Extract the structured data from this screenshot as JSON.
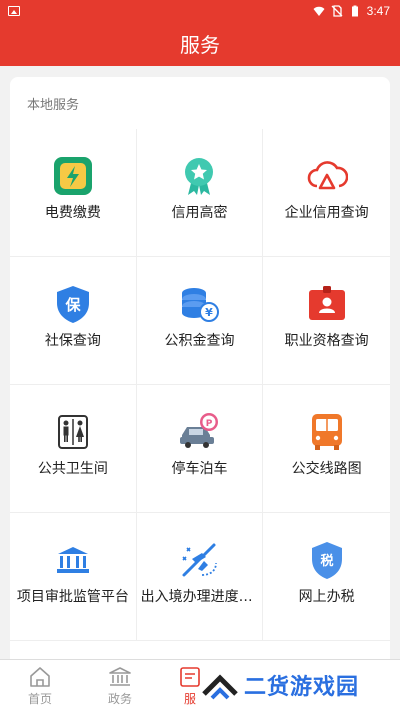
{
  "status_bar": {
    "time": "3:47"
  },
  "header": {
    "title": "服务"
  },
  "section": {
    "title": "本地服务"
  },
  "services": [
    {
      "label": "电费缴费",
      "icon": "electricity-bill-icon"
    },
    {
      "label": "信用高密",
      "icon": "credit-medal-icon"
    },
    {
      "label": "企业信用查询",
      "icon": "cloud-alert-icon"
    },
    {
      "label": "社保查询",
      "icon": "social-security-shield-icon"
    },
    {
      "label": "公积金查询",
      "icon": "fund-database-icon"
    },
    {
      "label": "职业资格查询",
      "icon": "id-badge-icon"
    },
    {
      "label": "公共卫生间",
      "icon": "restroom-icon"
    },
    {
      "label": "停车泊车",
      "icon": "parking-car-icon"
    },
    {
      "label": "公交线路图",
      "icon": "bus-icon"
    },
    {
      "label": "项目审批监管平台",
      "icon": "government-building-icon"
    },
    {
      "label": "出入境办理进度查…",
      "icon": "immigration-plane-icon"
    },
    {
      "label": "网上办税",
      "icon": "tax-shield-icon"
    }
  ],
  "tabs": [
    {
      "label": "首页",
      "icon": "home-icon"
    },
    {
      "label": "政务",
      "icon": "government-icon"
    },
    {
      "label": "服",
      "icon": "service-icon"
    }
  ],
  "watermark": {
    "text": "二货游戏园"
  },
  "colors": {
    "brand": "#e53a2e",
    "accent_blue": "#2a6fe0"
  }
}
